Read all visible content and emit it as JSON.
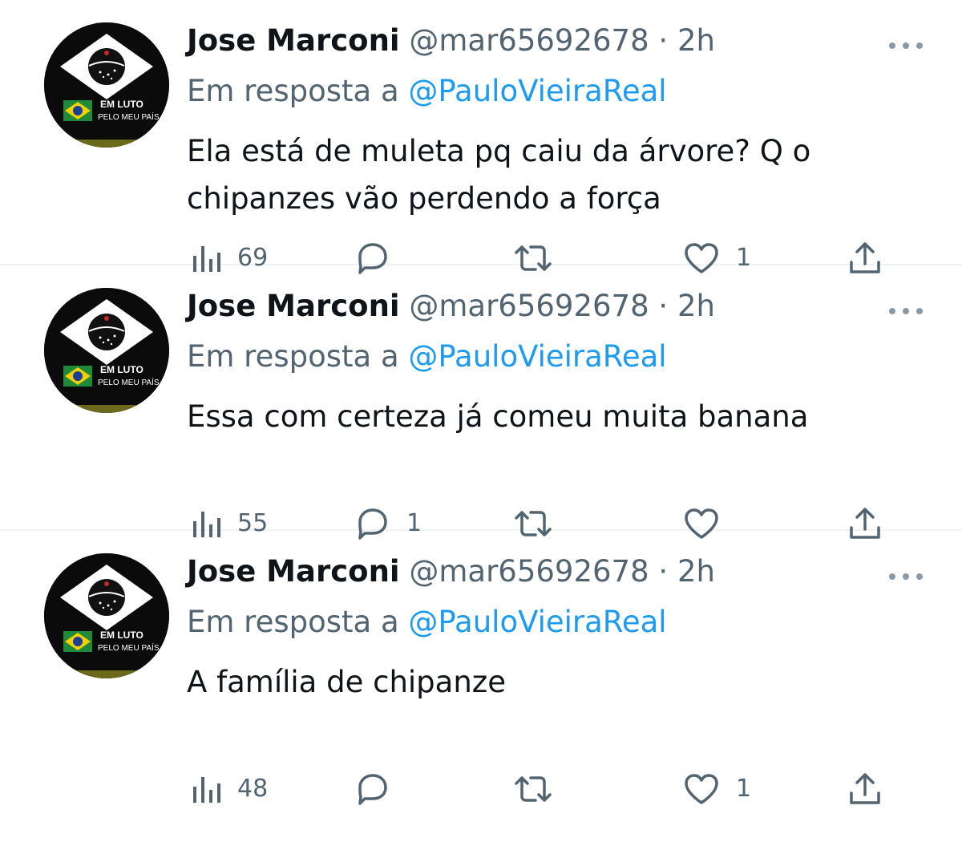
{
  "avatar": {
    "banner_line1": "EM LUTO",
    "banner_line2": "PELO MEU PAÍS"
  },
  "tweets": [
    {
      "name": "Jose Marconi",
      "handle": "@mar65692678",
      "separator": "·",
      "time": "2h",
      "reply_prefix": "Em resposta a",
      "reply_to": "@PauloVieiraReal",
      "text": "Ela está de muleta pq caiu da árvore? Q o chipanzes vão perdendo a força",
      "views": "69",
      "replies": "",
      "retweets": "",
      "likes": "1"
    },
    {
      "name": "Jose Marconi",
      "handle": "@mar65692678",
      "separator": "·",
      "time": "2h",
      "reply_prefix": "Em resposta a",
      "reply_to": "@PauloVieiraReal",
      "text": "Essa com certeza já comeu muita banana",
      "views": "55",
      "replies": "1",
      "retweets": "",
      "likes": ""
    },
    {
      "name": "Jose Marconi",
      "handle": "@mar65692678",
      "separator": "·",
      "time": "2h",
      "reply_prefix": "Em resposta a",
      "reply_to": "@PauloVieiraReal",
      "text": "A família de chipanze",
      "views": "48",
      "replies": "",
      "retweets": "",
      "likes": "1"
    }
  ],
  "colors": {
    "text_primary": "#0f1419",
    "text_secondary": "#536471",
    "mention": "#1d9bf0",
    "divider": "#eff3f4",
    "avatar_bg": "#0b0b0b"
  },
  "icons": [
    "views-icon",
    "reply-icon",
    "retweet-icon",
    "like-icon",
    "share-icon",
    "more-icon"
  ]
}
